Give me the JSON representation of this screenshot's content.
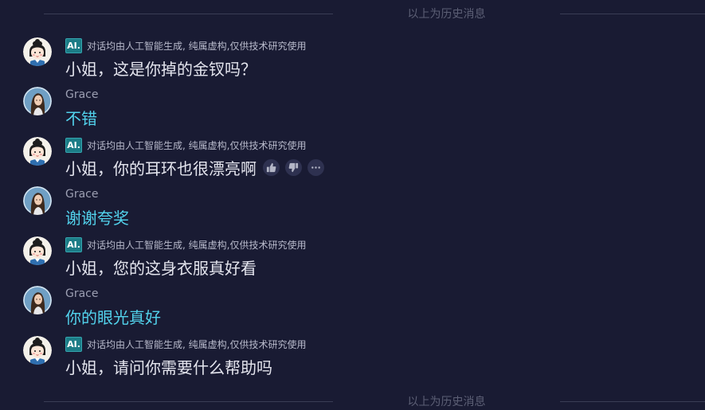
{
  "history_divider": {
    "text": "以上为历史消息"
  },
  "ai_disclaimer": "对话均由人工智能生成, 纯属虚构,仅供技术研究使用",
  "ai_badge_label": "AI.",
  "messages": [
    {
      "role": "bot",
      "text": "小姐，这是你掉的金钗吗？"
    },
    {
      "role": "user",
      "name": "Grace",
      "text": "不错"
    },
    {
      "role": "bot",
      "text": "小姐，你的耳环也很漂亮啊"
    },
    {
      "role": "user",
      "name": "Grace",
      "text": "谢谢夸奖"
    },
    {
      "role": "bot",
      "text": "小姐，您的这身衣服真好看"
    },
    {
      "role": "user",
      "name": "Grace",
      "text": "你的眼光真好"
    },
    {
      "role": "bot",
      "text": "小姐，请问你需要什么帮助吗"
    }
  ],
  "message_actions": [
    "thumbs-up-icon",
    "thumbs-down-icon",
    "more-icon"
  ],
  "colors": {
    "background": "#191b33",
    "user_text": "#52d2ec",
    "bot_text": "#e4e5ee",
    "ai_badge": "#1b7c86"
  }
}
